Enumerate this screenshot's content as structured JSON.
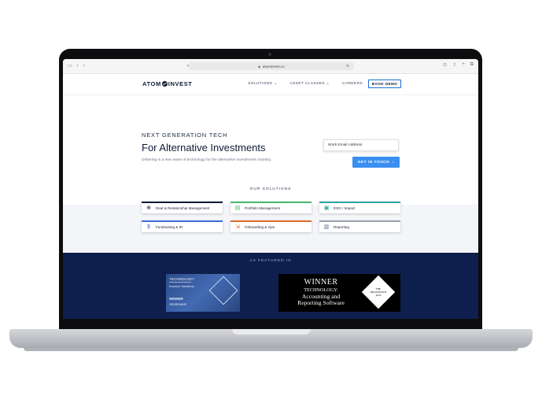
{
  "browser": {
    "url": "atominvest.co"
  },
  "nav": {
    "logo": "ATOM INVEST",
    "logo_left": "ATOM",
    "logo_right": "INVEST",
    "links": [
      "SOLUTIONS",
      "ASSET CLASSES",
      "CAREERS"
    ],
    "book_demo": "BOOK DEMO"
  },
  "hero": {
    "kicker": "NEXT GENERATION TECH",
    "title": "For Alternative Investments",
    "subtitle": "Ushering in a new wave of technology for the alternative investments industry.",
    "email_placeholder": "Work Email Address",
    "cta": "GET IN TOUCH"
  },
  "solutions": {
    "heading": "OUR SOLUTIONS",
    "cards": [
      {
        "label": "Deal & Relationship Management",
        "icon": "globe-icon",
        "color": "#0f1b33"
      },
      {
        "label": "Portfolio Management",
        "icon": "monitor-chart-icon",
        "color": "#48b86a"
      },
      {
        "label": "ESG / Impact",
        "icon": "image-icon",
        "color": "#2aa7a0"
      },
      {
        "label": "Fundraising & IR",
        "icon": "dollar-icon",
        "color": "#3a6fd8"
      },
      {
        "label": "Onboarding & Ops",
        "icon": "arrow-box-icon",
        "color": "#e46a2e"
      },
      {
        "label": "Reporting",
        "icon": "report-icon",
        "color": "#9aa3ad"
      }
    ]
  },
  "featured": {
    "heading": "AS FEATURED IN",
    "award1": {
      "category": "TECHNOLOGY",
      "sub": "Investor Solutions",
      "winner": "WINNER",
      "company": "AtomInvest"
    },
    "award2": {
      "winner": "WINNER",
      "category": "TECHNOLOGY:",
      "line1": "Accounting and",
      "line2": "Reporting Software",
      "badge_line1": "THE",
      "badge_line2": "DRAWDOWN",
      "badge_year": "2020"
    }
  }
}
